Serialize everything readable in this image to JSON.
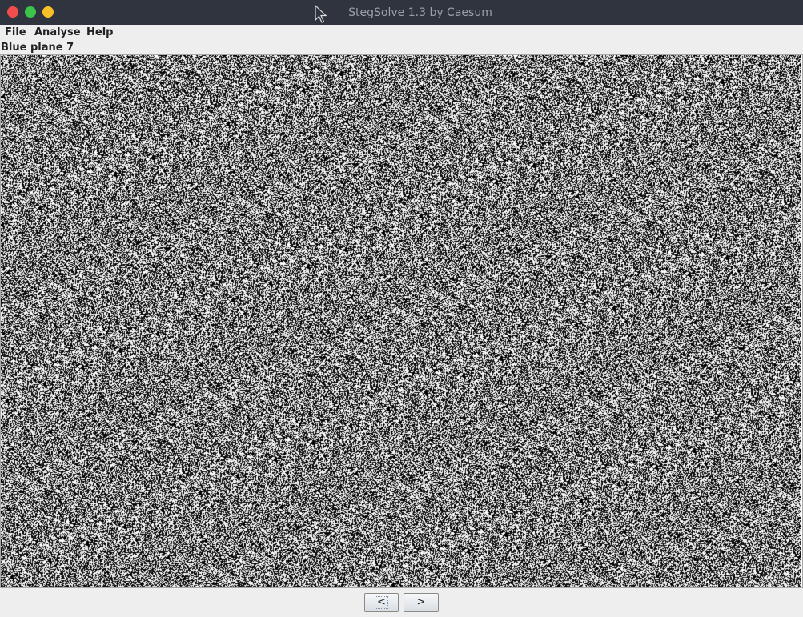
{
  "window": {
    "title": "StegSolve 1.3 by Caesum",
    "controls": {
      "close_color": "#f24d4d",
      "maximize_color": "#3cc44a",
      "minimize_color": "#f7c028"
    }
  },
  "menu": {
    "items": [
      {
        "label": "File"
      },
      {
        "label": "Analyse"
      },
      {
        "label": "Help"
      }
    ]
  },
  "viewer": {
    "plane_label": "Blue plane 7",
    "image_description_colors": {
      "on": "#000000",
      "off": "#ffffff"
    }
  },
  "navigation": {
    "prev_label": "<",
    "next_label": ">"
  },
  "colors": {
    "titlebar_bg": "#2f343f",
    "window_bg": "#eeeeee"
  }
}
